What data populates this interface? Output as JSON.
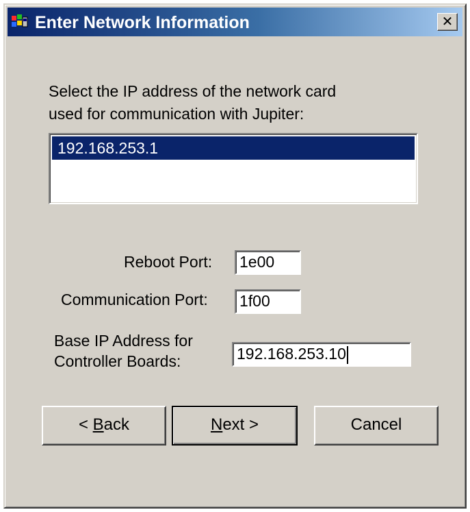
{
  "window": {
    "title": "Enter Network Information",
    "icon": "setup-wizard-icon",
    "close_label": "✕"
  },
  "prompt": {
    "line1": "Select the IP address of the network card",
    "line2": "used for communication with Jupiter:"
  },
  "ip_list": {
    "items": [
      "192.168.253.1"
    ],
    "selected_index": 0
  },
  "fields": {
    "reboot_port": {
      "label": "Reboot Port:",
      "value": "1e00"
    },
    "communication_port": {
      "label": "Communication Port:",
      "value": "1f00"
    },
    "base_ip": {
      "label_line1": "Base IP Address for",
      "label_line2": "Controller Boards:",
      "value": "192.168.253.10"
    }
  },
  "buttons": {
    "back": {
      "prefix": "< ",
      "accel": "B",
      "rest": "ack"
    },
    "next": {
      "prefix": "",
      "accel": "N",
      "rest": "ext >"
    },
    "cancel": {
      "label": "Cancel"
    }
  },
  "colors": {
    "face": "#d4d0c8",
    "title_start": "#0a246a",
    "title_end": "#a6caf0",
    "selection": "#0a246a"
  }
}
